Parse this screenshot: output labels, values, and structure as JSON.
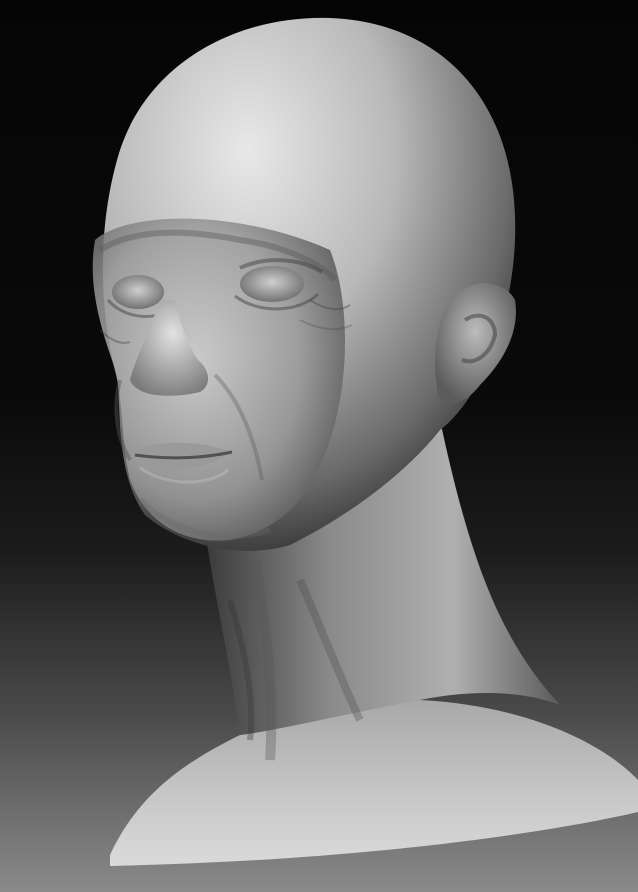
{
  "scene": {
    "subject": "sculpted-head-bust",
    "style": "grayscale-clay-render",
    "colors": {
      "background_top": "#050505",
      "background_bottom": "#8a8a8a",
      "clay_light": "#dcdcdc",
      "clay_mid": "#9a9a9a",
      "clay_dark": "#3a3a3a"
    }
  }
}
